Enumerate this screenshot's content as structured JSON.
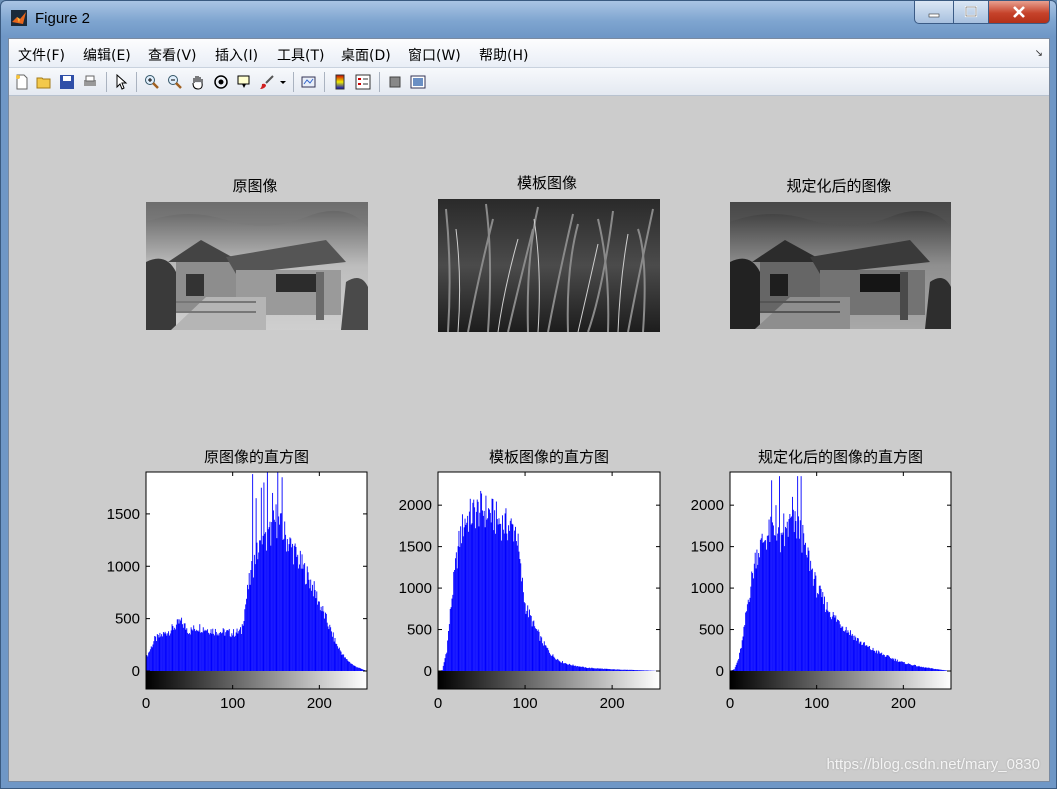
{
  "window": {
    "title": "Figure 2"
  },
  "menu": [
    {
      "label": "文件(F)"
    },
    {
      "label": "编辑(E)"
    },
    {
      "label": "查看(V)"
    },
    {
      "label": "插入(I)"
    },
    {
      "label": "工具(T)"
    },
    {
      "label": "桌面(D)"
    },
    {
      "label": "窗口(W)"
    },
    {
      "label": "帮助(H)"
    }
  ],
  "toolbar": [
    {
      "icon": "new-figure-icon"
    },
    {
      "icon": "open-file-icon"
    },
    {
      "icon": "save-icon"
    },
    {
      "icon": "print-icon"
    },
    {
      "icon": "edit-plot-arrow-icon"
    },
    {
      "icon": "zoom-in-icon"
    },
    {
      "icon": "zoom-out-icon"
    },
    {
      "icon": "pan-hand-icon"
    },
    {
      "icon": "rotate-3d-icon"
    },
    {
      "icon": "data-cursor-icon"
    },
    {
      "icon": "brush-icon"
    },
    {
      "icon": "link-plot-icon"
    },
    {
      "icon": "insert-colorbar-icon"
    },
    {
      "icon": "insert-legend-icon"
    },
    {
      "icon": "hide-plot-tools-icon"
    },
    {
      "icon": "show-plot-tools-icon"
    }
  ],
  "images": {
    "original_title": "原图像",
    "template_title": "模板图像",
    "matched_title": "规定化后的图像"
  },
  "chart_data": [
    {
      "type": "bar",
      "title": "原图像的直方图",
      "xlim": [
        0,
        255
      ],
      "ylim": [
        0,
        1900
      ],
      "xticks": [
        0,
        100,
        200
      ],
      "yticks": [
        0,
        500,
        1000,
        1500
      ],
      "bar_color": "#0000ff",
      "x": [
        0,
        10,
        20,
        30,
        40,
        50,
        60,
        70,
        80,
        90,
        100,
        110,
        118,
        125,
        130,
        140,
        150,
        160,
        170,
        180,
        190,
        200,
        210,
        220,
        230,
        240,
        250,
        255
      ],
      "values": [
        120,
        300,
        350,
        400,
        470,
        380,
        420,
        400,
        380,
        370,
        360,
        380,
        800,
        1050,
        1150,
        1250,
        1450,
        1300,
        1150,
        1000,
        850,
        650,
        450,
        250,
        120,
        50,
        15,
        0
      ],
      "spikes": [
        [
          123,
          1880
        ],
        [
          127,
          1650
        ],
        [
          133,
          1750
        ],
        [
          136,
          1800
        ],
        [
          140,
          1900
        ],
        [
          146,
          1700
        ],
        [
          152,
          1900
        ],
        [
          157,
          1850
        ]
      ]
    },
    {
      "type": "bar",
      "title": "模板图像的直方图",
      "xlim": [
        0,
        255
      ],
      "ylim": [
        0,
        2400
      ],
      "xticks": [
        0,
        100,
        200
      ],
      "yticks": [
        0,
        500,
        1000,
        1500,
        2000
      ],
      "bar_color": "#0000ff",
      "x": [
        0,
        5,
        10,
        15,
        20,
        25,
        30,
        40,
        50,
        60,
        70,
        80,
        90,
        95,
        100,
        110,
        120,
        130,
        140,
        150,
        170,
        200,
        230,
        255
      ],
      "values": [
        0,
        10,
        250,
        800,
        1250,
        1600,
        1800,
        1900,
        1950,
        1900,
        1800,
        1750,
        1700,
        1200,
        800,
        550,
        350,
        200,
        120,
        80,
        40,
        20,
        10,
        0
      ],
      "spikes": []
    },
    {
      "type": "bar",
      "title": "规定化后的图像的直方图",
      "xlim": [
        0,
        255
      ],
      "ylim": [
        0,
        2400
      ],
      "xticks": [
        0,
        100,
        200
      ],
      "yticks": [
        0,
        500,
        1000,
        1500,
        2000
      ],
      "bar_color": "#0000ff",
      "x": [
        0,
        5,
        10,
        15,
        20,
        25,
        30,
        40,
        50,
        60,
        70,
        80,
        90,
        100,
        110,
        120,
        130,
        140,
        150,
        160,
        180,
        200,
        220,
        240,
        255
      ],
      "values": [
        0,
        20,
        150,
        400,
        800,
        1100,
        1400,
        1600,
        1700,
        1500,
        1800,
        1700,
        1400,
        1000,
        800,
        650,
        550,
        450,
        350,
        280,
        180,
        100,
        50,
        20,
        0
      ],
      "spikes": [
        [
          48,
          2300
        ],
        [
          53,
          2000
        ],
        [
          57,
          2350
        ],
        [
          62,
          1900
        ],
        [
          66,
          1800
        ],
        [
          72,
          2100
        ],
        [
          78,
          2350
        ],
        [
          82,
          2350
        ],
        [
          88,
          1400
        ]
      ]
    }
  ],
  "watermark": "https://blog.csdn.net/mary_0830"
}
